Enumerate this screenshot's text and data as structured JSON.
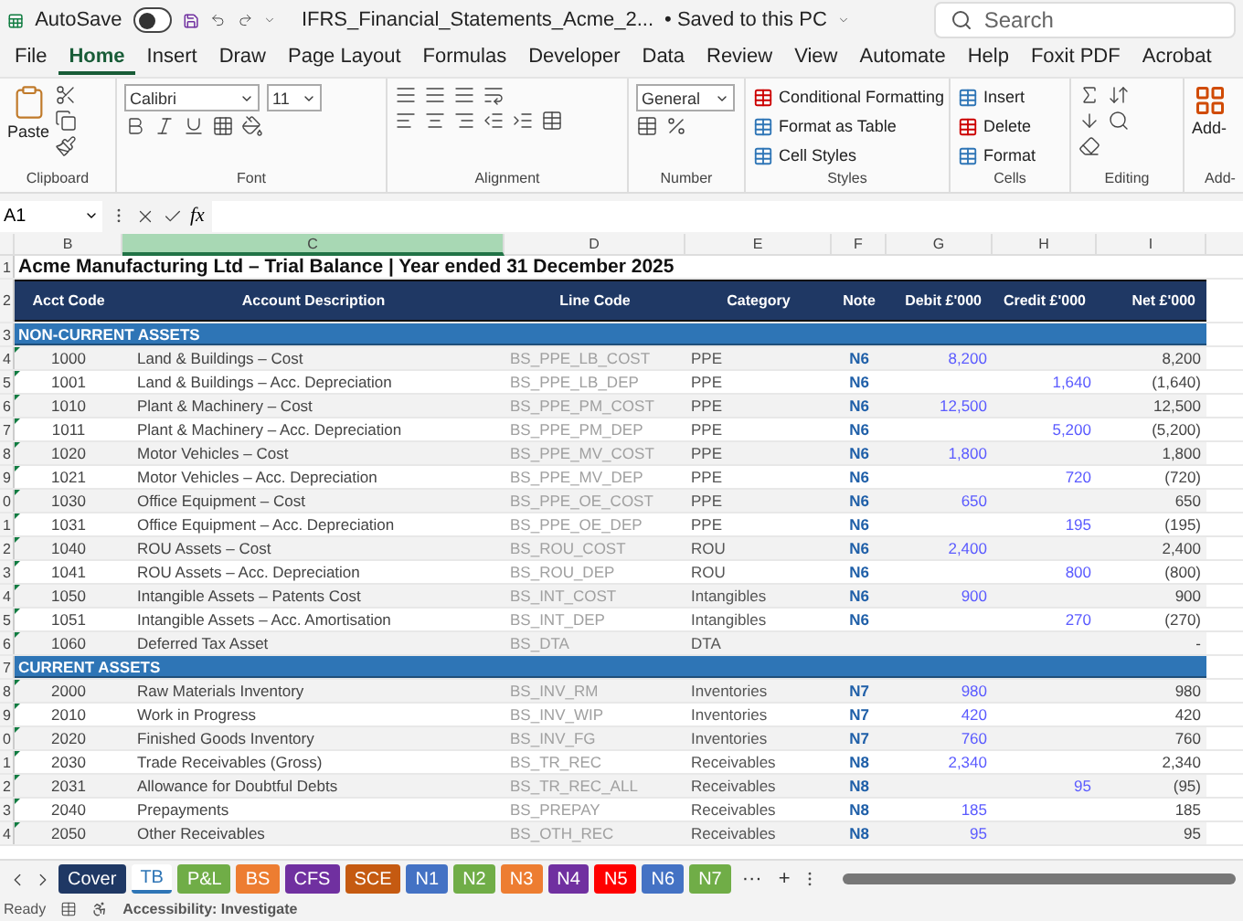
{
  "title_bar": {
    "autosave_label": "AutoSave",
    "autosave_on": false,
    "file_name": "IFRS_Financial_Statements_Acme_2...",
    "save_status": "• Saved to this PC",
    "search_placeholder": "Search"
  },
  "menu": [
    {
      "label": "File",
      "selected": false
    },
    {
      "label": "Home",
      "selected": true
    },
    {
      "label": "Insert",
      "selected": false
    },
    {
      "label": "Draw",
      "selected": false
    },
    {
      "label": "Page Layout",
      "selected": false
    },
    {
      "label": "Formulas",
      "selected": false
    },
    {
      "label": "Developer",
      "selected": false
    },
    {
      "label": "Data",
      "selected": false
    },
    {
      "label": "Review",
      "selected": false
    },
    {
      "label": "View",
      "selected": false
    },
    {
      "label": "Automate",
      "selected": false
    },
    {
      "label": "Help",
      "selected": false
    },
    {
      "label": "Foxit PDF",
      "selected": false
    },
    {
      "label": "Acrobat",
      "selected": false
    }
  ],
  "ribbon": {
    "paste": "Paste",
    "clipboard": "Clipboard",
    "font_name": "Calibri",
    "font_size": "11",
    "font": "Font",
    "alignment": "Alignment",
    "number_format": "General",
    "number": "Number",
    "conditional_formatting": "Conditional Formatting",
    "format_as_table": "Format as Table",
    "cell_styles": "Cell Styles",
    "styles": "Styles",
    "insert": "Insert",
    "delete": "Delete",
    "format": "Format",
    "cells": "Cells",
    "editing": "Editing",
    "addins_button": "Add-",
    "addins": "Add-"
  },
  "formula_bar": {
    "name_box": "A1",
    "fx_label": "fx"
  },
  "columns": [
    {
      "label": "B",
      "selected": false
    },
    {
      "label": "C",
      "selected": true
    },
    {
      "label": "D",
      "selected": false
    },
    {
      "label": "E",
      "selected": false
    },
    {
      "label": "F",
      "selected": false
    },
    {
      "label": "G",
      "selected": false
    },
    {
      "label": "H",
      "selected": false
    },
    {
      "label": "I",
      "selected": false
    }
  ],
  "sheet": {
    "title_row": "1",
    "title": "Acme Manufacturing Ltd – Trial Balance  |  Year ended 31 December 2025",
    "header_row": "2",
    "headers": [
      "Acct Code",
      "Account Description",
      "Line Code",
      "Category",
      "Note",
      "Debit £'000",
      "Credit £'000",
      "Net £'000"
    ],
    "sections": [
      {
        "row": "3",
        "title": "NON-CURRENT ASSETS",
        "rows": [
          {
            "row": "4",
            "code": "1000",
            "description": "Land & Buildings – Cost",
            "line_code": "BS_PPE_LB_COST",
            "category": "PPE",
            "note": "N6",
            "debit": "8,200",
            "credit": "",
            "net": "8,200"
          },
          {
            "row": "5",
            "code": "1001",
            "description": "Land & Buildings – Acc. Depreciation",
            "line_code": "BS_PPE_LB_DEP",
            "category": "PPE",
            "note": "N6",
            "debit": "",
            "credit": "1,640",
            "net": "(1,640)"
          },
          {
            "row": "6",
            "code": "1010",
            "description": "Plant & Machinery – Cost",
            "line_code": "BS_PPE_PM_COST",
            "category": "PPE",
            "note": "N6",
            "debit": "12,500",
            "credit": "",
            "net": "12,500"
          },
          {
            "row": "7",
            "code": "1011",
            "description": "Plant & Machinery – Acc. Depreciation",
            "line_code": "BS_PPE_PM_DEP",
            "category": "PPE",
            "note": "N6",
            "debit": "",
            "credit": "5,200",
            "net": "(5,200)"
          },
          {
            "row": "8",
            "code": "1020",
            "description": "Motor Vehicles – Cost",
            "line_code": "BS_PPE_MV_COST",
            "category": "PPE",
            "note": "N6",
            "debit": "1,800",
            "credit": "",
            "net": "1,800"
          },
          {
            "row": "9",
            "code": "1021",
            "description": "Motor Vehicles – Acc. Depreciation",
            "line_code": "BS_PPE_MV_DEP",
            "category": "PPE",
            "note": "N6",
            "debit": "",
            "credit": "720",
            "net": "(720)"
          },
          {
            "row": "0",
            "code": "1030",
            "description": "Office Equipment – Cost",
            "line_code": "BS_PPE_OE_COST",
            "category": "PPE",
            "note": "N6",
            "debit": "650",
            "credit": "",
            "net": "650"
          },
          {
            "row": "1",
            "code": "1031",
            "description": "Office Equipment – Acc. Depreciation",
            "line_code": "BS_PPE_OE_DEP",
            "category": "PPE",
            "note": "N6",
            "debit": "",
            "credit": "195",
            "net": "(195)"
          },
          {
            "row": "2",
            "code": "1040",
            "description": "ROU Assets – Cost",
            "line_code": "BS_ROU_COST",
            "category": "ROU",
            "note": "N6",
            "debit": "2,400",
            "credit": "",
            "net": "2,400"
          },
          {
            "row": "3",
            "code": "1041",
            "description": "ROU Assets – Acc. Depreciation",
            "line_code": "BS_ROU_DEP",
            "category": "ROU",
            "note": "N6",
            "debit": "",
            "credit": "800",
            "net": "(800)"
          },
          {
            "row": "4",
            "code": "1050",
            "description": "Intangible Assets – Patents Cost",
            "line_code": "BS_INT_COST",
            "category": "Intangibles",
            "note": "N6",
            "debit": "900",
            "credit": "",
            "net": "900"
          },
          {
            "row": "5",
            "code": "1051",
            "description": "Intangible Assets – Acc. Amortisation",
            "line_code": "BS_INT_DEP",
            "category": "Intangibles",
            "note": "N6",
            "debit": "",
            "credit": "270",
            "net": "(270)"
          },
          {
            "row": "6",
            "code": "1060",
            "description": "Deferred Tax Asset",
            "line_code": "BS_DTA",
            "category": "DTA",
            "note": "",
            "debit": "",
            "credit": "",
            "net": "-"
          }
        ]
      },
      {
        "row": "7",
        "title": "CURRENT ASSETS",
        "rows": [
          {
            "row": "8",
            "code": "2000",
            "description": "Raw Materials Inventory",
            "line_code": "BS_INV_RM",
            "category": "Inventories",
            "note": "N7",
            "debit": "980",
            "credit": "",
            "net": "980"
          },
          {
            "row": "9",
            "code": "2010",
            "description": "Work in Progress",
            "line_code": "BS_INV_WIP",
            "category": "Inventories",
            "note": "N7",
            "debit": "420",
            "credit": "",
            "net": "420"
          },
          {
            "row": "0",
            "code": "2020",
            "description": "Finished Goods Inventory",
            "line_code": "BS_INV_FG",
            "category": "Inventories",
            "note": "N7",
            "debit": "760",
            "credit": "",
            "net": "760"
          },
          {
            "row": "1",
            "code": "2030",
            "description": "Trade Receivables (Gross)",
            "line_code": "BS_TR_REC",
            "category": "Receivables",
            "note": "N8",
            "debit": "2,340",
            "credit": "",
            "net": "2,340"
          },
          {
            "row": "2",
            "code": "2031",
            "description": "Allowance for Doubtful Debts",
            "line_code": "BS_TR_REC_ALL",
            "category": "Receivables",
            "note": "N8",
            "debit": "",
            "credit": "95",
            "net": "(95)"
          },
          {
            "row": "3",
            "code": "2040",
            "description": "Prepayments",
            "line_code": "BS_PREPAY",
            "category": "Receivables",
            "note": "N8",
            "debit": "185",
            "credit": "",
            "net": "185"
          },
          {
            "row": "4",
            "code": "2050",
            "description": "Other Receivables",
            "line_code": "BS_OTH_REC",
            "category": "Receivables",
            "note": "N8",
            "debit": "95",
            "credit": "",
            "net": "95"
          }
        ]
      }
    ]
  },
  "sheet_tabs": [
    {
      "label": "Cover",
      "selected": false,
      "color": "#1f3864"
    },
    {
      "label": "TB",
      "selected": true,
      "color": "#2e75b6"
    },
    {
      "label": "P&L",
      "selected": false,
      "color": "#70ad47"
    },
    {
      "label": "BS",
      "selected": false,
      "color": "#ed7d31"
    },
    {
      "label": "CFS",
      "selected": false,
      "color": "#7030a0"
    },
    {
      "label": "SCE",
      "selected": false,
      "color": "#c55a11"
    },
    {
      "label": "N1",
      "selected": false,
      "color": "#4472c4"
    },
    {
      "label": "N2",
      "selected": false,
      "color": "#70ad47"
    },
    {
      "label": "N3",
      "selected": false,
      "color": "#ed7d31"
    },
    {
      "label": "N4",
      "selected": false,
      "color": "#7030a0"
    },
    {
      "label": "N5",
      "selected": false,
      "color": "#ff0000"
    },
    {
      "label": "N6",
      "selected": false,
      "color": "#4472c4"
    },
    {
      "label": "N7",
      "selected": false,
      "color": "#70ad47"
    }
  ],
  "tab_more": "···",
  "tab_add": "+",
  "status_bar": {
    "mode": "Ready",
    "accessibility": "Accessibility: Investigate"
  }
}
